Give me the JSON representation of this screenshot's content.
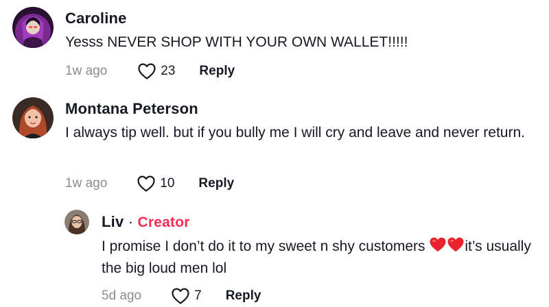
{
  "comments": [
    {
      "author": "Caroline",
      "text": "Yesss NEVER SHOP WITH YOUR OWN WALLET!!!!!",
      "time": "1w ago",
      "likes": "23",
      "reply_label": "Reply"
    },
    {
      "author": "Montana Peterson",
      "text": "I always tip well. but if you bully me I will cry and leave and never return.",
      "time": "1w ago",
      "likes": "10",
      "reply_label": "Reply"
    },
    {
      "author": "Liv",
      "separator": "·",
      "badge": "Creator",
      "text_before": "I promise I don’t do it to my sweet n shy customers ",
      "text_after": "it’s usually the big loud men lol",
      "time": "5d ago",
      "likes": "7",
      "reply_label": "Reply"
    }
  ],
  "colors": {
    "creator_badge": "#fe2c55",
    "timestamp": "#8a8b91",
    "text": "#161823"
  },
  "icons": {
    "like": "heart-outline-icon",
    "emoji": "red-heart-emoji"
  }
}
